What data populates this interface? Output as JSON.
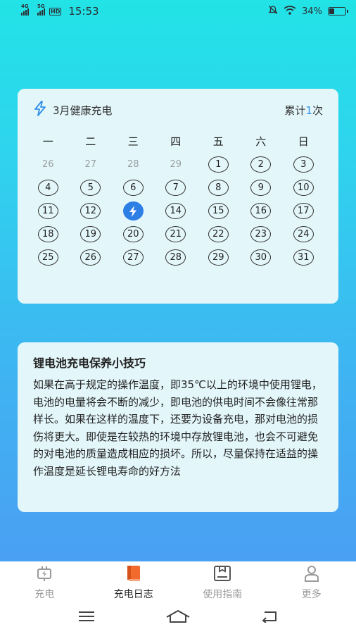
{
  "status_bar": {
    "net1": "4G",
    "net2": "5G",
    "hd": "HD",
    "time": "15:53",
    "battery_text": "34%",
    "battery_level": 0.34
  },
  "calendar": {
    "title": "3月健康充电",
    "count_prefix": "累计",
    "count_value": "1",
    "count_suffix": "次",
    "weekdays": [
      "一",
      "二",
      "三",
      "四",
      "五",
      "六",
      "日"
    ],
    "days": [
      {
        "label": "26",
        "state": "prev"
      },
      {
        "label": "27",
        "state": "prev"
      },
      {
        "label": "28",
        "state": "prev"
      },
      {
        "label": "29",
        "state": "prev"
      },
      {
        "label": "1",
        "state": "normal"
      },
      {
        "label": "2",
        "state": "normal"
      },
      {
        "label": "3",
        "state": "normal"
      },
      {
        "label": "4",
        "state": "normal"
      },
      {
        "label": "5",
        "state": "normal"
      },
      {
        "label": "6",
        "state": "normal"
      },
      {
        "label": "7",
        "state": "normal"
      },
      {
        "label": "8",
        "state": "normal"
      },
      {
        "label": "9",
        "state": "normal"
      },
      {
        "label": "10",
        "state": "normal"
      },
      {
        "label": "11",
        "state": "normal"
      },
      {
        "label": "12",
        "state": "normal"
      },
      {
        "label": "",
        "state": "charged"
      },
      {
        "label": "14",
        "state": "normal"
      },
      {
        "label": "15",
        "state": "normal"
      },
      {
        "label": "16",
        "state": "normal"
      },
      {
        "label": "17",
        "state": "normal"
      },
      {
        "label": "18",
        "state": "normal"
      },
      {
        "label": "19",
        "state": "normal"
      },
      {
        "label": "20",
        "state": "normal"
      },
      {
        "label": "21",
        "state": "normal"
      },
      {
        "label": "22",
        "state": "normal"
      },
      {
        "label": "23",
        "state": "normal"
      },
      {
        "label": "24",
        "state": "normal"
      },
      {
        "label": "25",
        "state": "normal"
      },
      {
        "label": "26",
        "state": "normal"
      },
      {
        "label": "27",
        "state": "normal"
      },
      {
        "label": "28",
        "state": "normal"
      },
      {
        "label": "29",
        "state": "normal"
      },
      {
        "label": "30",
        "state": "normal"
      },
      {
        "label": "31",
        "state": "normal"
      }
    ]
  },
  "tips": {
    "title": "锂电池充电保养小技巧",
    "body": "如果在高于规定的操作温度，即35℃以上的环境中使用锂电，电池的电量将会不断的减少，即电池的供电时间不会像往常那样长。如果在这样的温度下，还要为设备充电，那对电池的损伤将更大。即使是在较热的环境中存放锂电池，也会不可避免的对电池的质量造成相应的损坏。所以，尽量保持在适益的操作温度是延长锂电寿命的好方法"
  },
  "tabbar": {
    "tabs": [
      {
        "label": "充电",
        "icon": "charger-icon",
        "active": false
      },
      {
        "label": "充电日志",
        "icon": "book-icon",
        "active": true
      },
      {
        "label": "使用指南",
        "icon": "guide-icon",
        "active": false
      },
      {
        "label": "更多",
        "icon": "user-icon",
        "active": false
      }
    ]
  },
  "colors": {
    "accent": "#2f8fe8",
    "active_tab": "#f26a2c",
    "inactive_tab": "#9a9a9a"
  }
}
